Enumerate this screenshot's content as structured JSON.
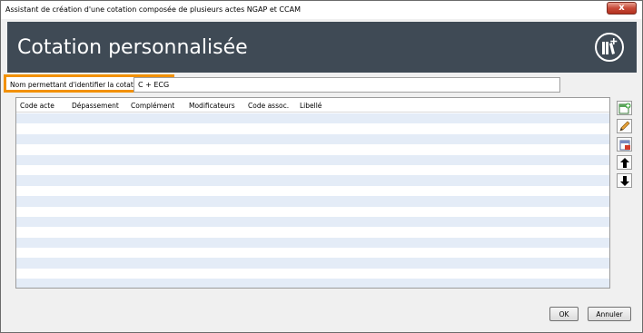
{
  "window": {
    "title": "Assistant de création d'une cotation composée de plusieurs actes NGAP et CCAM",
    "close_label": "x"
  },
  "header": {
    "title": "Cotation personnalisée",
    "logo_icon": "books-plus-icon"
  },
  "name_field": {
    "label": "Nom permettant d'identifier la cotation :",
    "value": "C + ECG"
  },
  "table": {
    "columns": [
      "Code acte",
      "Dépassement",
      "Complément",
      "Modificateurs",
      "Code assoc.",
      "Libellé"
    ],
    "row_colors": {
      "alt": "#e4ecf7",
      "base": "#ffffff"
    }
  },
  "toolbar": {
    "buttons": [
      "add-icon",
      "edit-icon",
      "delete-icon",
      "arrow-up-icon",
      "arrow-down-icon"
    ]
  },
  "footer": {
    "ok_label": "OK",
    "cancel_label": "Annuler"
  },
  "colors": {
    "header_bg": "#3f4a55",
    "highlight": "#f29100"
  }
}
